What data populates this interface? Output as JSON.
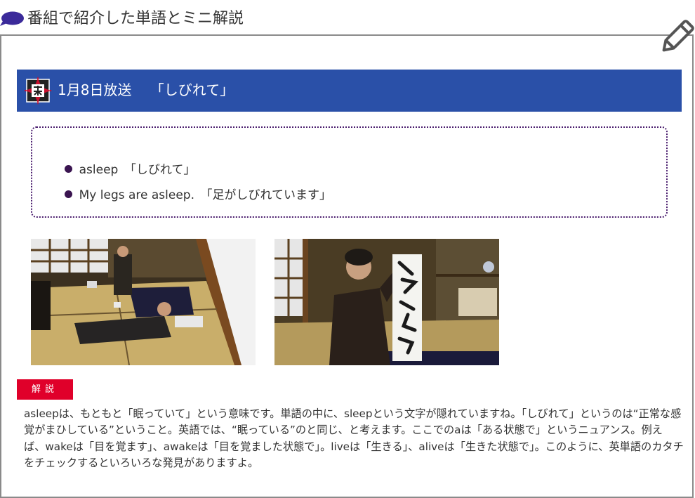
{
  "section": {
    "heading": "番組で紹介した単語とミニ解説"
  },
  "episode": {
    "title": "1月8日放送　 「しびれて」"
  },
  "vocab": [
    {
      "text": "asleep　「しびれて」"
    },
    {
      "text": "My legs are asleep.　「足がしびれています」"
    }
  ],
  "badge": {
    "label": "解説"
  },
  "explanation": {
    "text": "asleepは、もともと「眠っていて」という意味です。単語の中に、sleepという文字が隠れていますね。「しびれて」というのは“正常な感覚がまひしている”ということ。英語では、“眠っている”のと同じ、と考えます。ここでのaは「ある状態で」というニュアンス。例えば、wakeは「目を覚ます」、awakeは「目を覚ました状態で」。liveは「生きる」、aliveは「生きた状態で」。このように、英単語のカタチをチェックするといろいろな発見がありますよ。"
  },
  "colors": {
    "bar": "#2a50a8",
    "badge": "#e0002a",
    "box_border": "#4a1d6e",
    "speech_icon": "#3b2a9a"
  },
  "icons": {
    "heading": "speech-bubble-icon",
    "corner": "pencil-icon",
    "bar_logo": "program-logo"
  }
}
